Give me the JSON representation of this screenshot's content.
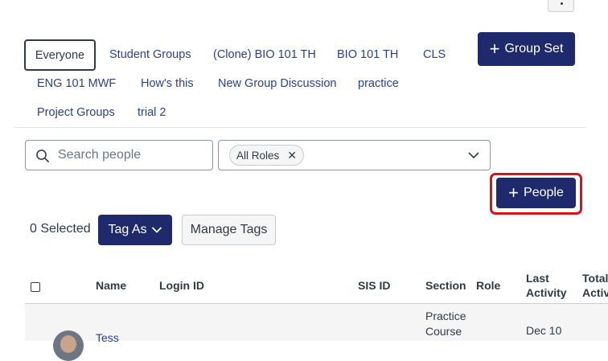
{
  "colors": {
    "brand": "#1e2a6b",
    "link": "#2b3f8f",
    "highlight": "#d7131b",
    "text": "#2d3b45"
  },
  "header": {
    "kebab_icon": "ellipsis-vertical-icon"
  },
  "group_tabs": {
    "row1": [
      "Everyone",
      "Student Groups",
      "(Clone) BIO 101 TH",
      "BIO 101 TH",
      "CLS"
    ],
    "row2": [
      "ENG 101 MWF",
      "How's this",
      "New Group Discussion",
      "practice"
    ],
    "row3": [
      "Project Groups",
      "trial 2"
    ],
    "active": "Everyone"
  },
  "group_set_button": {
    "icon": "plus-icon",
    "label": "Group Set"
  },
  "search": {
    "placeholder": "Search people",
    "value": "",
    "icon": "search-icon"
  },
  "role_filter": {
    "selected": "All Roles",
    "remove_icon": "close-icon",
    "dropdown_icon": "chevron-down-icon"
  },
  "people_button": {
    "icon": "plus-icon",
    "label": "People"
  },
  "toolbar": {
    "selected_text": "0 Selected",
    "tag_as_label": "Tag As",
    "manage_tags_label": "Manage Tags"
  },
  "table": {
    "headers": {
      "name": "Name",
      "login_id": "Login ID",
      "sis_id": "SIS ID",
      "section": "Section",
      "role": "Role",
      "last_activity_1": "Last",
      "last_activity_2": "Activity",
      "total_activity_1": "Total",
      "total_activity_2": "Activity"
    },
    "rows": [
      {
        "name": "Tess",
        "section_1": "Practice",
        "section_2": "Course",
        "last_activity": "Dec 10"
      }
    ]
  }
}
